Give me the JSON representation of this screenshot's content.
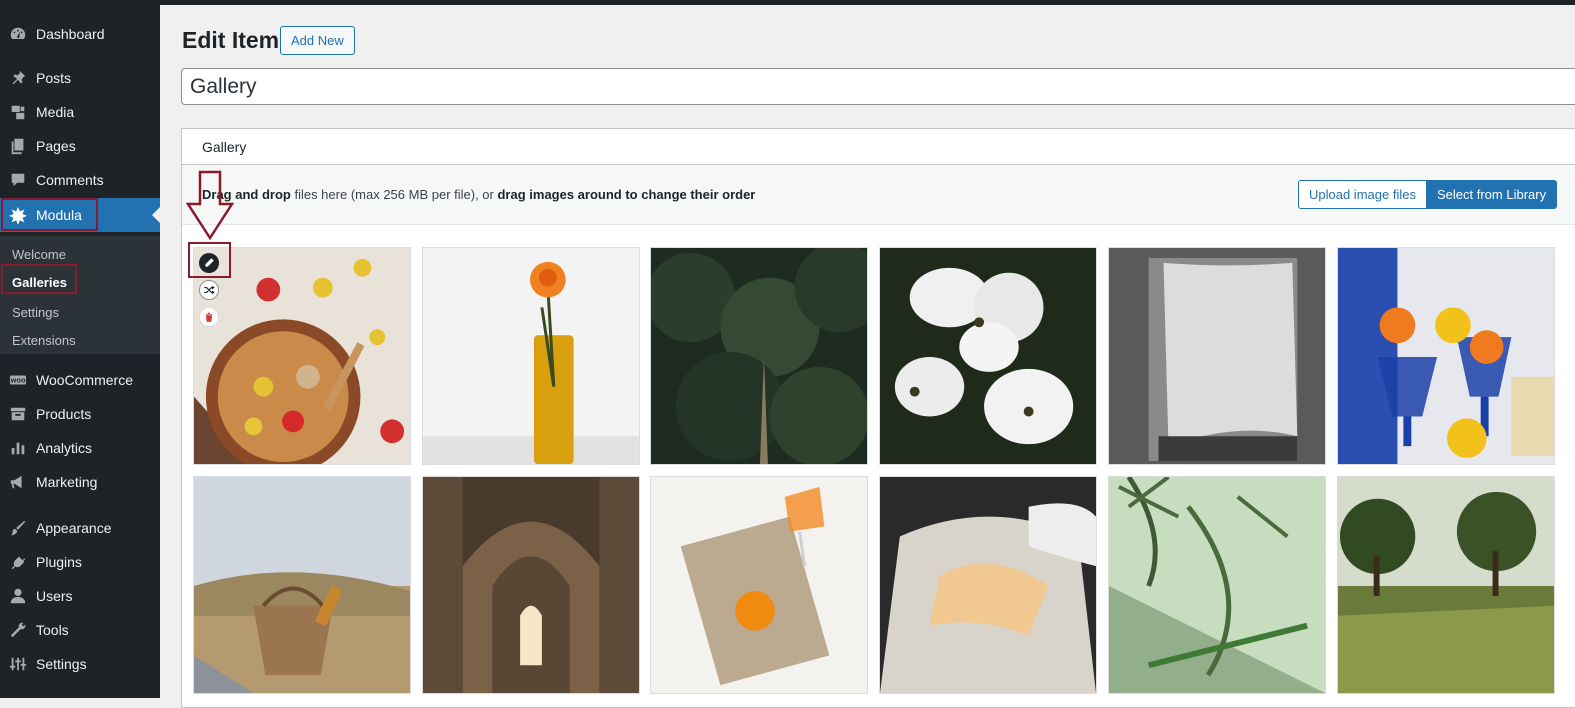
{
  "sidebar": {
    "items": [
      {
        "label": "Dashboard",
        "icon": "dashboard-icon"
      },
      {
        "label": "Posts",
        "icon": "pin-icon"
      },
      {
        "label": "Media",
        "icon": "media-icon"
      },
      {
        "label": "Pages",
        "icon": "pages-icon"
      },
      {
        "label": "Comments",
        "icon": "comment-icon"
      },
      {
        "label": "Modula",
        "icon": "modula-icon"
      },
      {
        "label": "WooCommerce",
        "icon": "woocommerce-icon"
      },
      {
        "label": "Products",
        "icon": "archive-icon"
      },
      {
        "label": "Analytics",
        "icon": "bar-chart-icon"
      },
      {
        "label": "Marketing",
        "icon": "megaphone-icon"
      },
      {
        "label": "Appearance",
        "icon": "brush-icon"
      },
      {
        "label": "Plugins",
        "icon": "plug-icon"
      },
      {
        "label": "Users",
        "icon": "user-icon"
      },
      {
        "label": "Tools",
        "icon": "wrench-icon"
      },
      {
        "label": "Settings",
        "icon": "sliders-icon"
      }
    ],
    "submenu": [
      "Welcome",
      "Galleries",
      "Settings",
      "Extensions"
    ],
    "active_color": "#2271b1"
  },
  "header": {
    "title": "Edit Item",
    "add_new": "Add New"
  },
  "title_field": {
    "value": "Gallery"
  },
  "panel": {
    "tab": "Gallery",
    "drop_bold_1": "Drag and drop",
    "drop_plain_1": " files here (max 256 MB per file), or ",
    "drop_bold_2": "drag images around to change their order",
    "upload_label": "Upload image files",
    "library_label": "Select from Library"
  },
  "annotation_color": "#8b1a2c"
}
